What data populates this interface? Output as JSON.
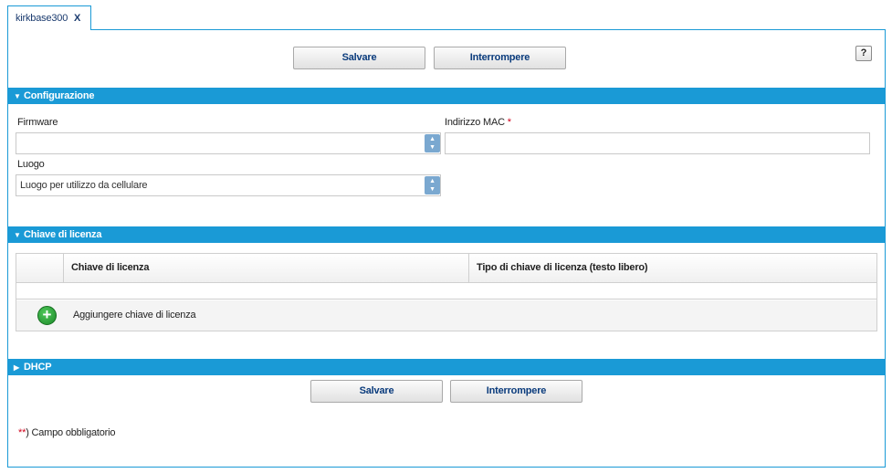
{
  "tab": {
    "title": "kirkbase300",
    "close": "X"
  },
  "toolbar": {
    "save_label": "Salvare",
    "cancel_label": "Interrompere",
    "help_label": "?"
  },
  "sections": {
    "configurazione": {
      "title": "Configurazione",
      "firmware_label": "Firmware",
      "firmware_value": "",
      "mac_label": "Indirizzo MAC",
      "mac_required": "*",
      "mac_value": "",
      "luogo_label": "Luogo",
      "luogo_value": "Luogo per utilizzo da cellulare"
    },
    "chiave": {
      "title": "Chiave di licenza",
      "columns": [
        "Chiave di licenza",
        "Tipo di chiave di licenza (testo libero)"
      ],
      "add_label": "Aggiungere chiave di licenza"
    },
    "dhcp": {
      "title": "DHCP"
    }
  },
  "footer": {
    "required_marker": "*",
    "required_note": ") Campo obbligatorio"
  },
  "icons": {
    "expanded": "triangle-down",
    "collapsed": "triangle-right",
    "spinner": "up-down-arrows",
    "add": "plus-circle"
  },
  "colors": {
    "accent": "#1a9ad6",
    "button_text": "#0a3b7c",
    "required": "#d0021b",
    "add": "#2a9d36"
  }
}
